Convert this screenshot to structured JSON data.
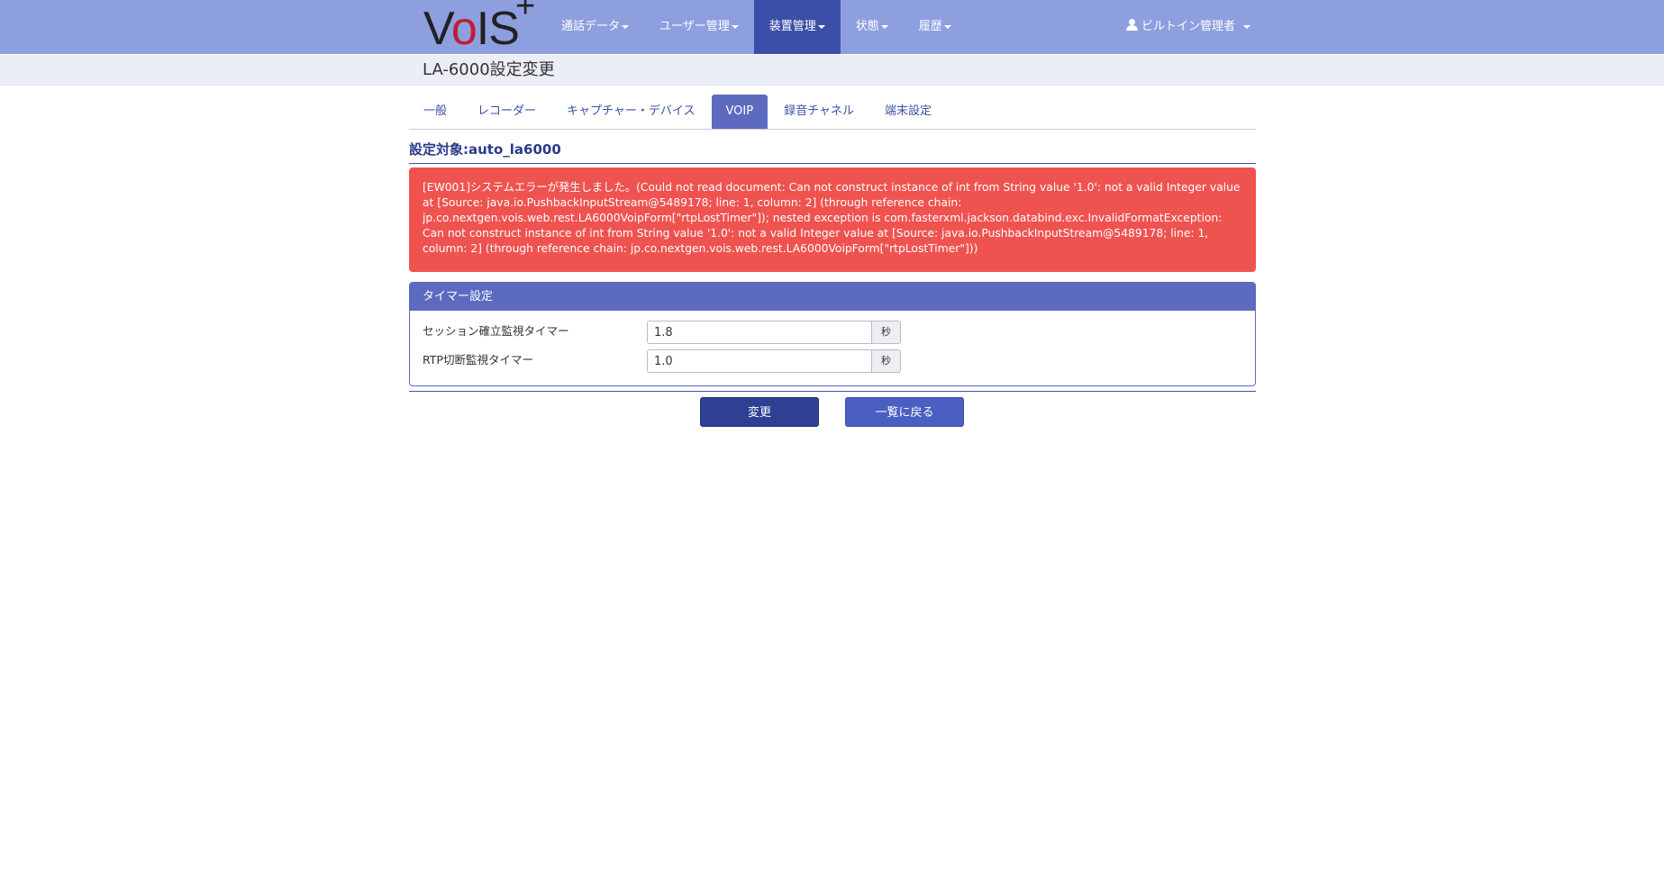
{
  "navbar": {
    "logo": {
      "prefix": "V",
      "o": "o",
      "suffix": "IS",
      "plus": "+"
    },
    "items": [
      {
        "label": "通話データ"
      },
      {
        "label": "ユーザー管理"
      },
      {
        "label": "装置管理",
        "active": true
      },
      {
        "label": "状態"
      },
      {
        "label": "履歴"
      }
    ],
    "user": "ビルトイン管理者",
    "background": "#8e9fe0",
    "active_background": "#3b4fa8"
  },
  "page": {
    "title": "LA-6000設定変更"
  },
  "tabs": [
    {
      "label": "一般"
    },
    {
      "label": "レコーダー"
    },
    {
      "label": "キャプチャー・デバイス"
    },
    {
      "label": "VOIP",
      "active": true
    },
    {
      "label": "録音チャネル"
    },
    {
      "label": "端末設定"
    }
  ],
  "target": "設定対象:auto_la6000",
  "alert": {
    "message": "[EW001]システムエラーが発生しました。(Could not read document: Can not construct instance of int from String value '1.0': not a valid Integer value at [Source: java.io.PushbackInputStream@5489178; line: 1, column: 2] (through reference chain: jp.co.nextgen.vois.web.rest.LA6000VoipForm[\"rtpLostTimer\"]); nested exception is com.fasterxml.jackson.databind.exc.InvalidFormatException: Can not construct instance of int from String value '1.0': not a valid Integer value at [Source: java.io.PushbackInputStream@5489178; line: 1, column: 2] (through reference chain: jp.co.nextgen.vois.web.rest.LA6000VoipForm[\"rtpLostTimer\"]))",
    "color": "#ef5350"
  },
  "panel": {
    "heading": "タイマー設定",
    "fields": [
      {
        "label": "セッション確立監視タイマー",
        "value": "1.8",
        "unit": "秒"
      },
      {
        "label": "RTP切断監視タイマー",
        "value": "1.0",
        "unit": "秒"
      }
    ]
  },
  "buttons": {
    "submit": "変更",
    "back": "一覧に戻る"
  }
}
